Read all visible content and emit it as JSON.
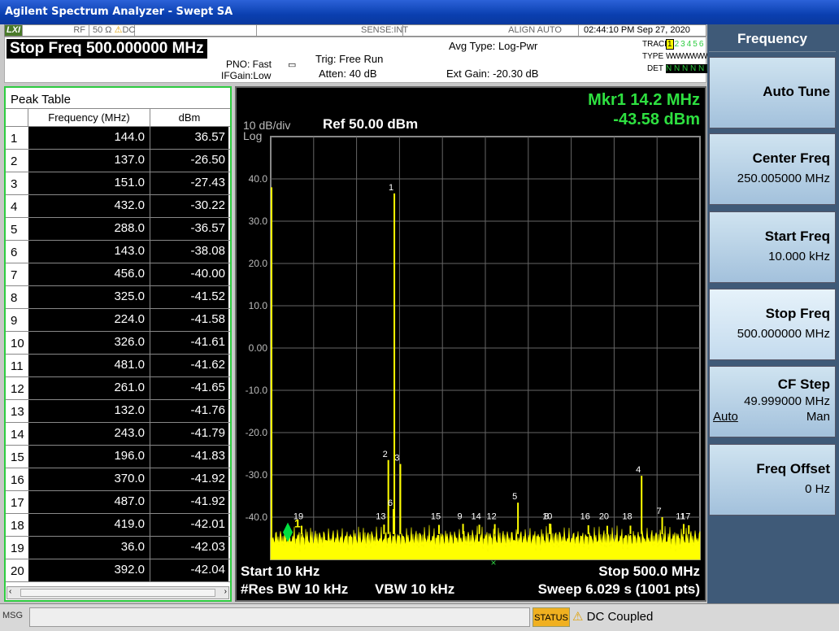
{
  "window": {
    "title": "Agilent Spectrum Analyzer - Swept SA"
  },
  "status_strip": {
    "lxi": "LXI",
    "rf": "RF",
    "impedance": "50 Ω",
    "warning_icon": "warning-icon",
    "coupling": "DC",
    "sense": "SENSE:INT",
    "align": "ALIGN AUTO",
    "datetime": "02:44:10 PM Sep 27, 2020"
  },
  "header": {
    "stop_freq": "Stop Freq 500.000000 MHz",
    "pno": "PNO: Fast",
    "ifgain": "IFGain:Low",
    "trig": "Trig: Free Run",
    "atten": "Atten: 40 dB",
    "avg_type": "Avg Type: Log-Pwr",
    "ext_gain": "Ext Gain: -20.30 dB",
    "trace_label": "TRACE",
    "type_label": "TYPE",
    "det_label": "DET",
    "traces": [
      "1",
      "2",
      "3",
      "4",
      "5",
      "6"
    ],
    "type_value": "WWWWWW",
    "det_value": "N N N N N N"
  },
  "peak_table": {
    "title": "Peak Table",
    "col_freq": "Frequency (MHz)",
    "col_dbm": "dBm",
    "rows": [
      {
        "n": "1",
        "f": "144.0",
        "d": "36.57"
      },
      {
        "n": "2",
        "f": "137.0",
        "d": "-26.50"
      },
      {
        "n": "3",
        "f": "151.0",
        "d": "-27.43"
      },
      {
        "n": "4",
        "f": "432.0",
        "d": "-30.22"
      },
      {
        "n": "5",
        "f": "288.0",
        "d": "-36.57"
      },
      {
        "n": "6",
        "f": "143.0",
        "d": "-38.08"
      },
      {
        "n": "7",
        "f": "456.0",
        "d": "-40.00"
      },
      {
        "n": "8",
        "f": "325.0",
        "d": "-41.52"
      },
      {
        "n": "9",
        "f": "224.0",
        "d": "-41.58"
      },
      {
        "n": "10",
        "f": "326.0",
        "d": "-41.61"
      },
      {
        "n": "11",
        "f": "481.0",
        "d": "-41.62"
      },
      {
        "n": "12",
        "f": "261.0",
        "d": "-41.65"
      },
      {
        "n": "13",
        "f": "132.0",
        "d": "-41.76"
      },
      {
        "n": "14",
        "f": "243.0",
        "d": "-41.79"
      },
      {
        "n": "15",
        "f": "196.0",
        "d": "-41.83"
      },
      {
        "n": "16",
        "f": "370.0",
        "d": "-41.92"
      },
      {
        "n": "17",
        "f": "487.0",
        "d": "-41.92"
      },
      {
        "n": "18",
        "f": "419.0",
        "d": "-42.01"
      },
      {
        "n": "19",
        "f": "36.0",
        "d": "-42.03"
      },
      {
        "n": "20",
        "f": "392.0",
        "d": "-42.04"
      }
    ]
  },
  "graph": {
    "scale": "10 dB/div",
    "log": "Log",
    "ref": "Ref 50.00 dBm",
    "marker_freq": "Mkr1 14.2 MHz",
    "marker_amp": "-43.58 dBm",
    "start": "Start 10 kHz",
    "stop": "Stop 500.0 MHz",
    "rbw": "#Res BW 10 kHz",
    "vbw": "VBW 10 kHz",
    "sweep": "Sweep  6.029 s (1001 pts)",
    "y_ticks": [
      "40.0",
      "30.0",
      "20.0",
      "10.0",
      "0.00",
      "-10.0",
      "-20.0",
      "-30.0",
      "-40.0"
    ],
    "marker_label": "1",
    "accent": "#ffff00",
    "marker_color": "#00e040"
  },
  "softkeys": {
    "header": "Frequency",
    "auto_tune": "Auto Tune",
    "center": "Center Freq",
    "center_val": "250.005000 MHz",
    "start": "Start Freq",
    "start_val": "10.000 kHz",
    "stop": "Stop Freq",
    "stop_val": "500.000000 MHz",
    "cf_step": "CF Step",
    "cf_step_val": "49.999000 MHz",
    "auto": "Auto",
    "man": "Man",
    "offset": "Freq Offset",
    "offset_val": "0 Hz"
  },
  "msgbar": {
    "msg": "MSG",
    "status": "STATUS",
    "dc": "DC Coupled"
  }
}
